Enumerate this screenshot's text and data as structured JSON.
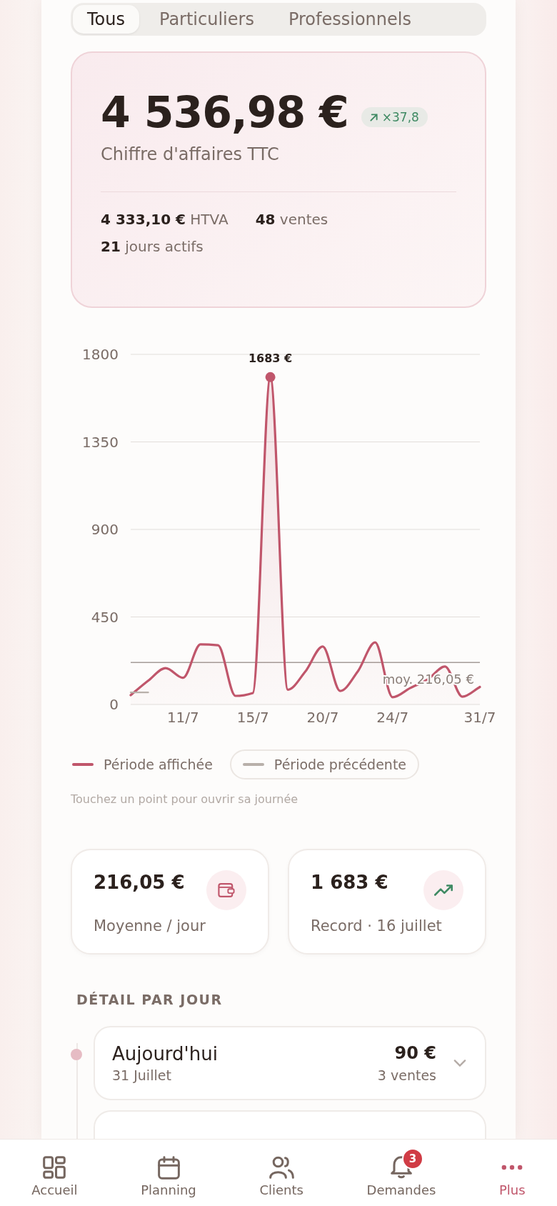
{
  "tabs": [
    {
      "label": "Tous",
      "selected": true
    },
    {
      "label": "Particuliers",
      "selected": false
    },
    {
      "label": "Professionnels",
      "selected": false
    }
  ],
  "summary": {
    "total": "4 536,98 €",
    "trend": "×37,8",
    "label": "Chiffre d'affaires TTC",
    "stats": [
      "**4 333,10 €** HTVA",
      "**48** ventes",
      "**21** jours actifs"
    ]
  },
  "chart": {
    "chart_data": {
      "type": "area",
      "grid": true,
      "categories": [
        null,
        null,
        null,
        "11/7",
        null,
        null,
        null,
        "15/7",
        null,
        null,
        null,
        "20/7",
        null,
        null,
        null,
        "24/7",
        null,
        null,
        null,
        null,
        "31/7"
      ],
      "ylim": [
        0,
        1800
      ],
      "yticks": [
        0,
        450,
        900,
        1350,
        1800
      ],
      "series": [
        {
          "name": "Période affichée",
          "color": "#c0566b",
          "values": [
            48,
            122,
            187,
            137,
            309,
            304,
            44,
            59,
            1683,
            76,
            169,
            298,
            69,
            169,
            319,
            37,
            84,
            128,
            195,
            40,
            90
          ]
        },
        {
          "name": "Période précédente",
          "type": "line",
          "color": "#b8b0aa",
          "values": [
            62,
            62,
            null,
            null,
            null,
            null,
            null,
            null,
            null,
            null,
            null,
            null,
            null,
            null,
            null,
            null,
            null,
            null,
            null,
            null,
            null
          ]
        }
      ],
      "annotations": [
        {
          "y": 1683,
          "text": "1683 €"
        }
      ],
      "ref_lines": [
        {
          "axis": "y",
          "value": 216.05,
          "label": "moy. 216,05 €"
        }
      ]
    },
    "legend": [
      {
        "selected": false
      },
      {
        "selected": true
      }
    ],
    "hint": "Touchez un point pour ouvrir sa journée"
  },
  "stat_cards": [
    {
      "value": "216,05 €",
      "label": "Moyenne / jour"
    },
    {
      "value": "1 683 €",
      "label": "Record · 16 juillet"
    }
  ],
  "detail": {
    "heading": "DÉTAIL PAR JOUR",
    "days": [
      {
        "label": "Aujourd'hui",
        "date": "31 Juillet",
        "amount": "90 €",
        "sales": "3 ventes",
        "expanded": false
      }
    ]
  },
  "nav": [
    {
      "label": "Accueil",
      "selected": false
    },
    {
      "label": "Planning",
      "selected": false
    },
    {
      "label": "Clients",
      "selected": false
    },
    {
      "label": "Demandes",
      "selected": false,
      "badge": "3"
    },
    {
      "label": "Plus",
      "selected": true
    }
  ]
}
